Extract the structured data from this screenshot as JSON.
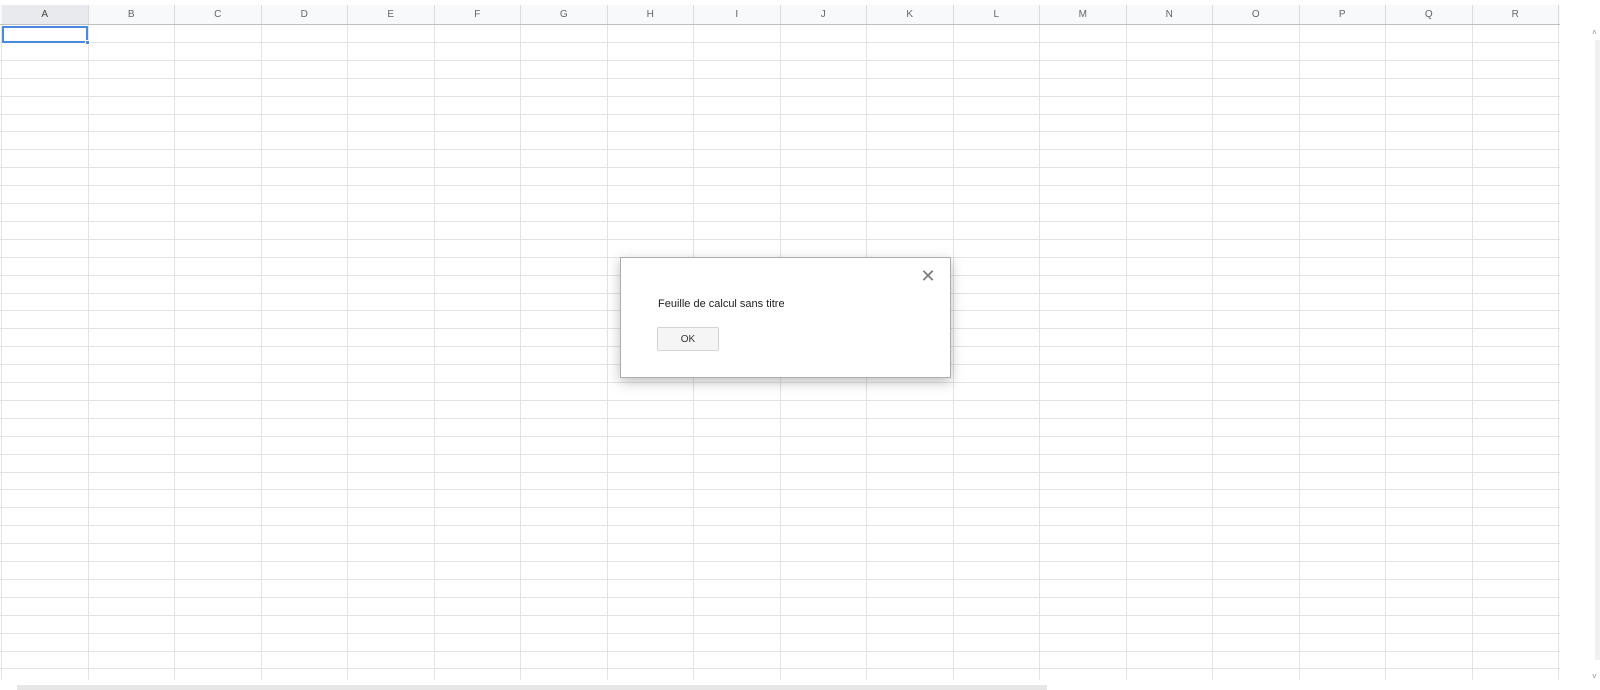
{
  "columns": [
    "A",
    "B",
    "C",
    "D",
    "E",
    "F",
    "G",
    "H",
    "I",
    "J",
    "K",
    "L",
    "M",
    "N",
    "O",
    "P",
    "Q",
    "R"
  ],
  "selected_column": "A",
  "active_cell": "A1",
  "dialog": {
    "message": "Feuille de calcul sans titre",
    "ok_label": "OK",
    "close_icon": "close-icon"
  },
  "scrollbars": {
    "up_arrow": "˄",
    "down_arrow": "˅"
  },
  "colors": {
    "selection": "#4a89dc",
    "gridline": "#e2e3e3",
    "header_bg": "#f8f9fa"
  }
}
